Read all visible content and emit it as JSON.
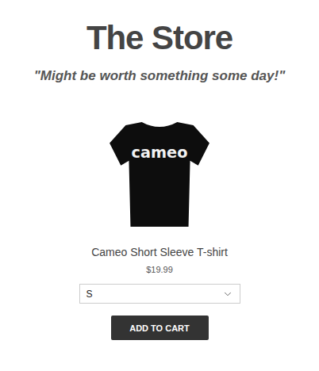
{
  "store": {
    "title": "The Store",
    "tagline": "\"Might be worth something some day!\""
  },
  "product": {
    "image_text": "cameo",
    "name": "Cameo Short Sleeve T-shirt",
    "price": "$19.99",
    "size": "S",
    "button": "ADD TO CART"
  }
}
